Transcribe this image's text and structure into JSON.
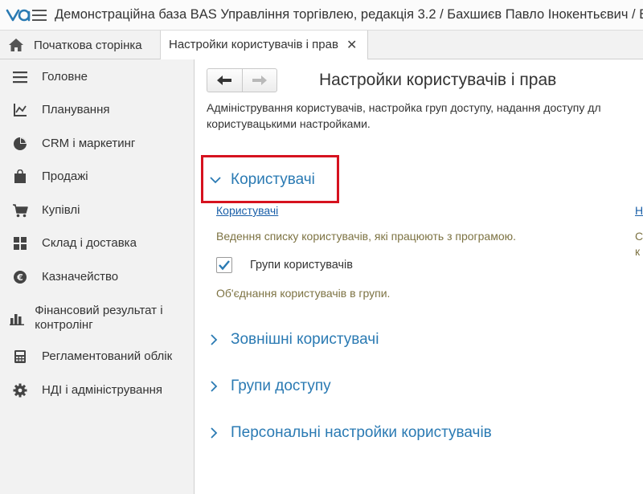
{
  "window": {
    "title": "Демонстраційна база BAS Управління торгівлею, редакція 3.2 / Бахшиєв Павло Інокентьєвич / BAS"
  },
  "tabs": [
    {
      "label": "Початкова сторінка"
    },
    {
      "label": "Настройки користувачів і прав"
    }
  ],
  "sidebar": {
    "items": [
      {
        "label": "Головне",
        "icon": "menu-lines-icon"
      },
      {
        "label": "Планування",
        "icon": "planning-axes-icon"
      },
      {
        "label": "CRM і маркетинг",
        "icon": "pie-chart-icon"
      },
      {
        "label": "Продажі",
        "icon": "shopping-bag-icon"
      },
      {
        "label": "Купівлі",
        "icon": "cart-icon"
      },
      {
        "label": "Склад і доставка",
        "icon": "warehouse-grid-icon"
      },
      {
        "label": "Казначейство",
        "icon": "coin-icon"
      },
      {
        "label": "Фінансовий результат і контролінг",
        "icon": "bar-chart-icon"
      },
      {
        "label": "Регламентований облік",
        "icon": "calculator-icon"
      },
      {
        "label": "НДІ і адміністрування",
        "icon": "gear-icon"
      }
    ]
  },
  "main": {
    "title": "Настройки користувачів і прав",
    "description_line1": "Адміністрування користувачів, настройка груп доступу, надання доступу дл",
    "description_line2": "користувацькими настройками.",
    "sections": [
      {
        "label": "Користувачі",
        "expanded": true
      },
      {
        "label": "Зовнішні користувачі",
        "expanded": false
      },
      {
        "label": "Групи доступу",
        "expanded": false
      },
      {
        "label": "Персональні настройки користувачів",
        "expanded": false
      }
    ],
    "users_link": "Користувачі",
    "users_hint": "Ведення списку користувачів, які працюють з програмою.",
    "user_groups_label": "Групи користувачів",
    "user_groups_checked": true,
    "user_groups_hint": "Об'єднання користувачів в групи.",
    "right_clip_link": "Н",
    "right_clip_hint1": "С",
    "right_clip_hint2": "к"
  },
  "colors": {
    "accent": "#2a7ab3",
    "highlight_border": "#d6121f",
    "hint_text": "#7d7343",
    "check": "#2a7ab3"
  }
}
